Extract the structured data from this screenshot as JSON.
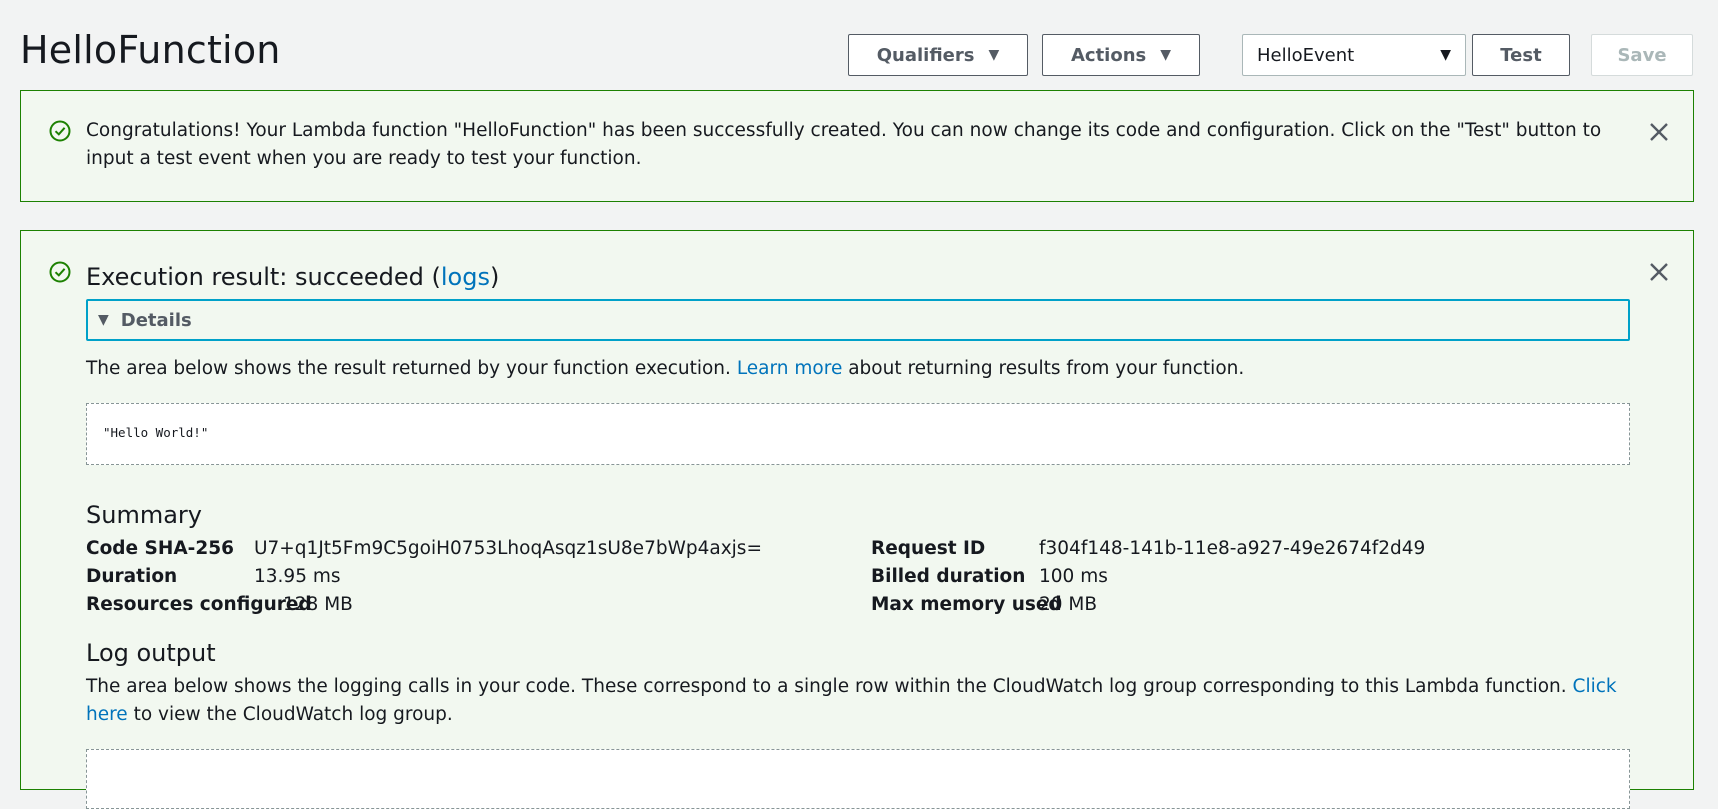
{
  "page": {
    "title": "HelloFunction"
  },
  "toolbar": {
    "qualifiers_label": "Qualifiers",
    "actions_label": "Actions",
    "test_event_selected": "HelloEvent",
    "test_label": "Test",
    "save_label": "Save"
  },
  "congrats": {
    "message": "Congratulations! Your Lambda function \"HelloFunction\" has been successfully created. You can now change its code and configuration. Click on the \"Test\" button to input a test event when you are ready to test your function."
  },
  "execution": {
    "title_prefix": "Execution result: succeeded (",
    "logs_link": "logs",
    "title_suffix": ")",
    "details_label": "Details",
    "result_desc_prefix": "The area below shows the result returned by your function execution. ",
    "learn_more_link": "Learn more",
    "result_desc_suffix": " about returning results from your function.",
    "result_value": "\"Hello World!\""
  },
  "summary": {
    "heading": "Summary",
    "left": [
      {
        "label": "Code SHA-256",
        "value": "U7+q1Jt5Fm9C5goiH0753LhoqAsqz1sU8e7bWp4axjs="
      },
      {
        "label": "Duration",
        "value": "13.95 ms"
      },
      {
        "label": "Resources configured",
        "value": "128 MB"
      }
    ],
    "right": [
      {
        "label": "Request ID",
        "value": "f304f148-141b-11e8-a927-49e2674f2d49"
      },
      {
        "label": "Billed duration",
        "value": "100 ms"
      },
      {
        "label": "Max memory used",
        "value": "20 MB"
      }
    ]
  },
  "log": {
    "heading": "Log output",
    "desc_prefix": "The area below shows the logging calls in your code. These correspond to a single row within the CloudWatch log group corresponding to this Lambda function. ",
    "click_here_link": "Click here",
    "desc_suffix": " to view the CloudWatch log group."
  },
  "icons": {
    "success": "check-circle-icon",
    "close": "close-icon",
    "dropdown": "caret-down-icon",
    "details_toggle": "triangle-down-icon"
  },
  "colors": {
    "success_green": "#1d8102",
    "panel_bg": "#f2f8f0",
    "link_blue": "#0073bb",
    "focus_cyan": "#00a1c9"
  }
}
